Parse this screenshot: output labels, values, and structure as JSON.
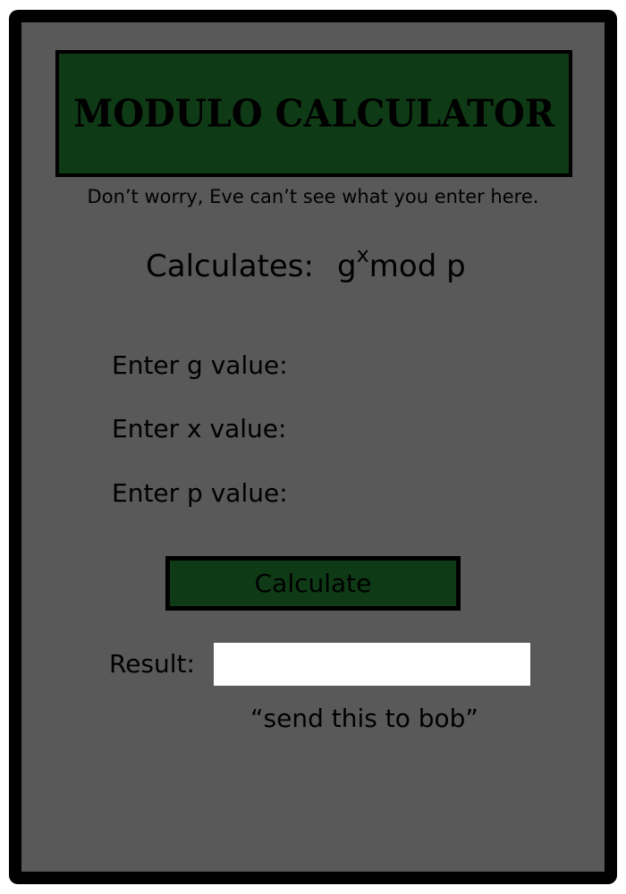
{
  "header": {
    "title": "Modulo Calculator",
    "subtitle": "Don’t worry, Eve can’t see what you enter here."
  },
  "formula": {
    "prefix": "Calculates:",
    "base": "g",
    "exponent": "x",
    "suffix": "mod p"
  },
  "fields": {
    "g_label": "Enter g value:",
    "g_value": "",
    "x_label": "Enter x value:",
    "x_value": "",
    "p_label": "Enter p value:",
    "p_value": ""
  },
  "actions": {
    "calculate_label": "Calculate"
  },
  "result": {
    "label": "Result:",
    "value": "",
    "hint": "“send this to bob”"
  },
  "colors": {
    "panel": "#595959",
    "frame": "#000000",
    "accent_green": "#0f3a16",
    "result_box": "#ffffff"
  }
}
